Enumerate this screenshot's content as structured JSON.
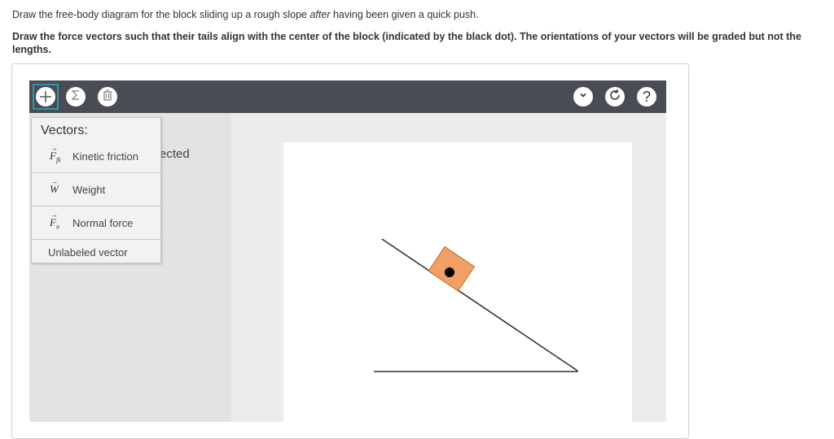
{
  "question": {
    "prompt_before": "Draw the free-body diagram for the block sliding up a rough slope ",
    "prompt_em": "after",
    "prompt_after": " having been given a quick push.",
    "instructions": "Draw the force vectors such that their tails align with the center of the block (indicated by the black dot). The orientations of your vectors will be graded but not the lengths."
  },
  "toolbar": {
    "left_icons": [
      "plus-icon",
      "sum-icon",
      "trash-icon"
    ],
    "right_icons": [
      "chevron-down-icon",
      "reset-icon",
      "help-icon"
    ],
    "help_glyph": "?"
  },
  "menu": {
    "title": "Vectors:",
    "items": [
      {
        "symbol": "F",
        "subscript": "fk",
        "label": "Kinetic friction"
      },
      {
        "symbol": "W",
        "subscript": "",
        "label": "Weight"
      },
      {
        "symbol": "F",
        "subscript": "n",
        "label": "Normal force"
      }
    ],
    "plain_item": "Unlabeled vector"
  },
  "sidebar": {
    "partial_text": "ected"
  },
  "colors": {
    "toolbar": "#4a4c55",
    "accent": "#2a9aa8",
    "block": "#f0a067"
  }
}
